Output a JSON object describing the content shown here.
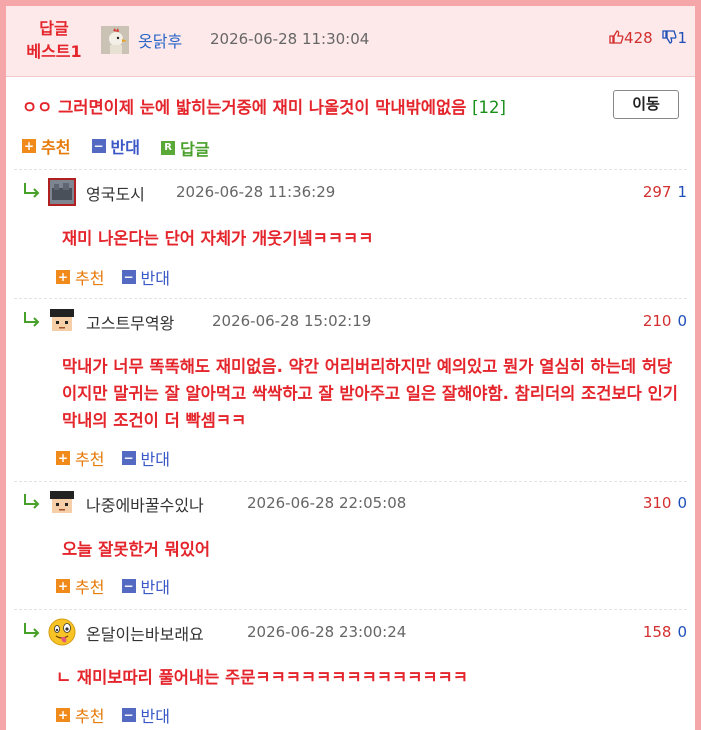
{
  "best": {
    "badge_line1": "답글",
    "badge_line2": "베스트1",
    "nickname": "옷닭후",
    "date": "2026-06-28 11:30:04",
    "upvotes": "428",
    "downvotes": "1",
    "text": "ㅇㅇ 그러면이제 눈에 밟히는거중에 재미 나올것이 막내밖에없음",
    "reply_count": "[12]",
    "move_label": "이동",
    "recommend_label": "추천",
    "oppose_label": "반대",
    "reply_label": "답글"
  },
  "comments": [
    {
      "nickname": "영국도시",
      "date": "2026-06-28 11:36:29",
      "up": "297",
      "down": "1",
      "text": "재미 나온다는 단어 자체가 개웃기넼ㅋㅋㅋㅋ",
      "recommend": "추천",
      "oppose": "반대"
    },
    {
      "nickname": "고스트무역왕",
      "date": "2026-06-28 15:02:19",
      "up": "210",
      "down": "0",
      "text": "막내가 너무 똑똑해도 재미없음. 약간 어리버리하지만 예의있고 뭔가 열심히 하는데 허당이지만 말귀는 잘 알아먹고 싹싹하고 잘 받아주고 일은 잘해야함. 참리더의 조건보다 인기막내의 조건이 더 빡셈ㅋㅋ",
      "recommend": "추천",
      "oppose": "반대"
    },
    {
      "nickname": "나중에바꿀수있나",
      "date": "2026-06-28 22:05:08",
      "up": "310",
      "down": "0",
      "text": "오늘 잘못한거 뭐있어",
      "recommend": "추천",
      "oppose": "반대"
    },
    {
      "nickname": "온달이는바보래요",
      "date": "2026-06-28 23:00:24",
      "up": "158",
      "down": "0",
      "text": "ㄴ 재미보따리 풀어내는 주문ㅋㅋㅋㅋㅋㅋㅋㅋㅋㅋㅋㅋㅋㅋ",
      "recommend": "추천",
      "oppose": "반대"
    }
  ],
  "icons": {
    "upvote": "thumbs-up-icon",
    "downvote": "thumbs-down-icon",
    "reply_arrow": "reply-arrow-icon",
    "plus": "plus-box-icon",
    "minus": "minus-box-icon",
    "reply_box": "reply-box-icon"
  },
  "colors": {
    "accent_red": "#e4252c",
    "border_pink": "#f4a6a9",
    "header_bg": "#fde8ea",
    "recommend_orange": "#f08a1b",
    "oppose_blue": "#5469c2",
    "reply_green": "#5aa838"
  }
}
